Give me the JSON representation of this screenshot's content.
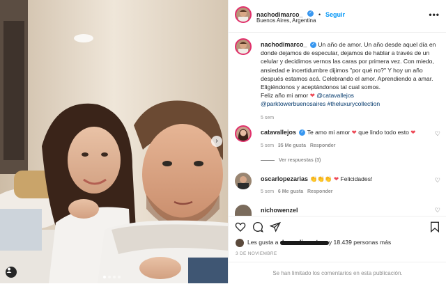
{
  "post": {
    "username": "nachodimarco_",
    "follow_label": "Seguir",
    "location": "Buenos Aires, Argentina",
    "more_label": "•••",
    "verified_mark": "✓",
    "caption_lines": [
      "Un año de amor. Un año desde aquel día en",
      "donde dejamos de especular, dejamos de hablar a través de un",
      "celular y decidimos vernos las caras por primera vez. Con miedo,",
      "ansiedad e incertidumbre dijimos \"por qué no?\" Y hoy un año",
      "después estamos acá. Celebrando el amor. Aprendiendo a amar.",
      "Eligiéndonos y aceptándonos tal cual somos."
    ],
    "caption_closing": "Feliz año mi amor",
    "caption_mention": "@catavallejos",
    "caption_mention2": "@parktowerbuenosaires",
    "caption_hashtag": "#theluxurycollection",
    "caption_time": "5 sem"
  },
  "comments": [
    {
      "username": "catavallejos",
      "text": "Te amo mi amor",
      "text2": "que lindo todo esto",
      "time": "5 sem",
      "likes": "35 Me gusta",
      "reply": "Responder"
    },
    {
      "username": "oscarlopezarias",
      "text": "Felicidades!",
      "time": "5 sem",
      "likes": "6 Me gusta",
      "reply": "Responder"
    },
    {
      "username": "nichowenzel"
    }
  ],
  "replies_label": "Ver respuestas (3)",
  "likes": {
    "prefix": "Les gusta a",
    "hidden_user": "dawnalimnxt_m",
    "suffix": "y 18.439 personas más"
  },
  "date": "3 DE NOVIEMBRE",
  "comments_closed": "Se han limitado los comentarios en esta publicación.",
  "colors": {
    "heart": "#ed4956",
    "link": "#00376b",
    "follow": "#0095f6",
    "verified": "#3897f0"
  }
}
